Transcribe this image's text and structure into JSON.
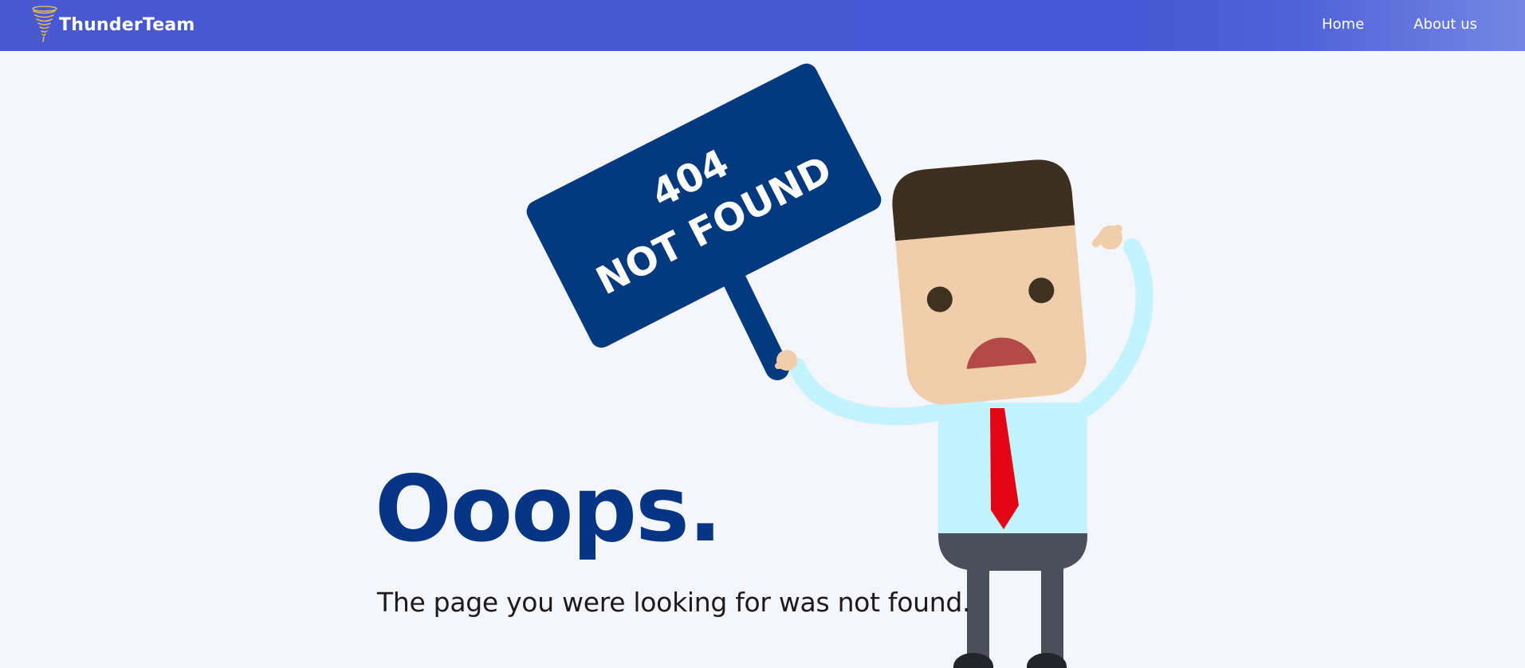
{
  "navbar": {
    "brand": "ThunderTeam",
    "brand_icon": "tornado-logo-icon",
    "links": [
      {
        "label": "Home"
      },
      {
        "label": "About us"
      }
    ],
    "colors": {
      "background": "#4658d3",
      "text": "#ffffff"
    }
  },
  "sign": {
    "line1": "404",
    "line2": "NOT FOUND",
    "color": "#043a80"
  },
  "main": {
    "heading": "Ooops.",
    "message": "The page you were looking for was not found.",
    "heading_color": "#053584"
  }
}
